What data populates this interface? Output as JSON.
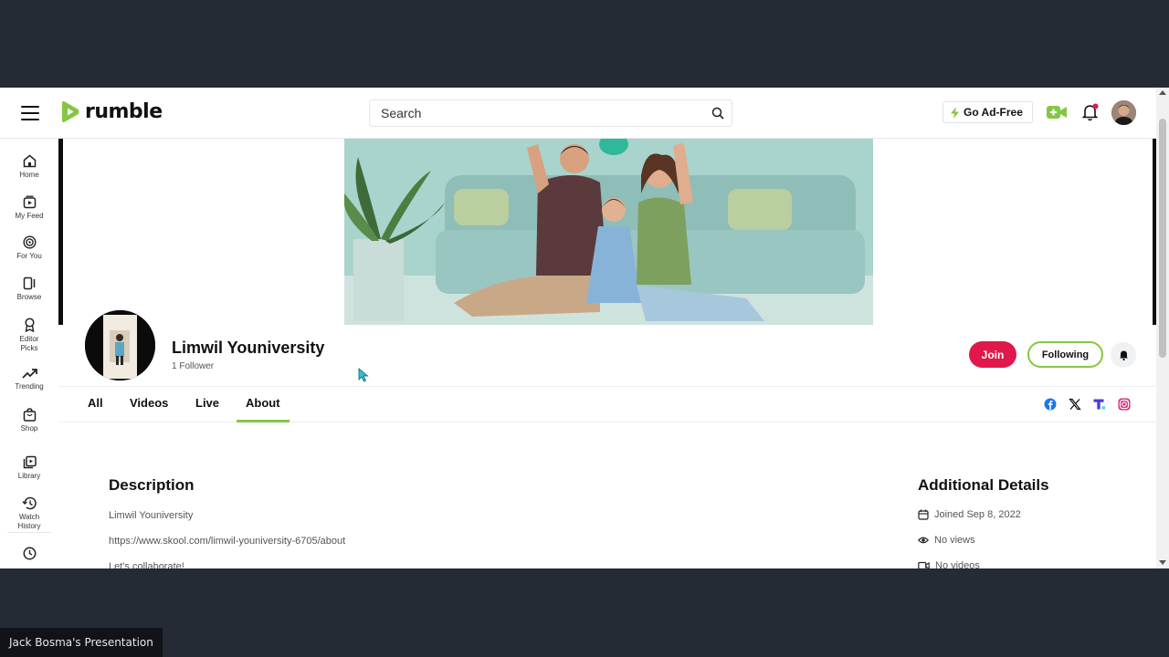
{
  "header": {
    "brand": "rumble",
    "search_placeholder": "Search",
    "ad_free_label": "Go Ad-Free"
  },
  "sidebar": {
    "items": [
      {
        "label": "Home",
        "icon": "home-icon"
      },
      {
        "label": "My Feed",
        "icon": "feed-icon"
      },
      {
        "label": "For You",
        "icon": "target-icon"
      },
      {
        "label": "Browse",
        "icon": "browse-icon"
      },
      {
        "label": "Editor Picks",
        "icon": "award-icon"
      },
      {
        "label": "Trending",
        "icon": "trending-icon"
      },
      {
        "label": "Shop",
        "icon": "shop-icon"
      },
      {
        "label": "Library",
        "icon": "library-icon"
      },
      {
        "label": "Watch History",
        "icon": "history-icon"
      },
      {
        "label": "",
        "icon": "clock-icon"
      }
    ]
  },
  "channel": {
    "name": "Limwil Youniversity",
    "followers": "1 Follower",
    "join_label": "Join",
    "following_label": "Following"
  },
  "tabs": [
    {
      "label": "All"
    },
    {
      "label": "Videos"
    },
    {
      "label": "Live"
    },
    {
      "label": "About",
      "active": true
    }
  ],
  "about": {
    "description_title": "Description",
    "lines": [
      "Limwil Youniversity",
      "https://www.skool.com/limwil-youniversity-6705/about",
      "Let's collaborate!"
    ],
    "details_title": "Additional Details",
    "joined": "Joined Sep 8, 2022",
    "views": "No views",
    "videos": "No videos"
  },
  "presenter": "Jack Bosma's Presentation",
  "colors": {
    "brand_green": "#85c742",
    "join_red": "#e0184b",
    "background": "#252b35"
  }
}
